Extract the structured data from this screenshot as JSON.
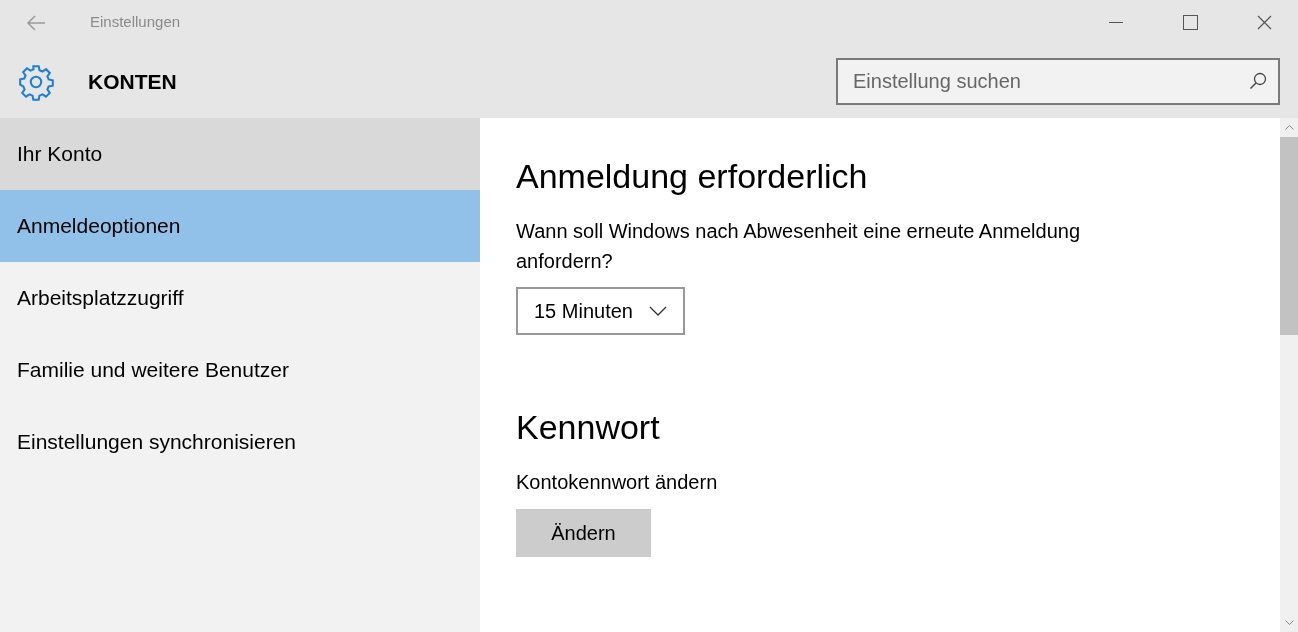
{
  "window": {
    "title": "Einstellungen"
  },
  "header": {
    "title": "KONTEN",
    "search": {
      "placeholder": "Einstellung suchen"
    }
  },
  "sidebar": {
    "items": [
      {
        "label": "Ihr Konto",
        "selected": false,
        "hovered": true
      },
      {
        "label": "Anmeldeoptionen",
        "selected": true,
        "hovered": false
      },
      {
        "label": "Arbeitsplatzzugriff",
        "selected": false,
        "hovered": false
      },
      {
        "label": "Familie und weitere Benutzer",
        "selected": false,
        "hovered": false
      },
      {
        "label": "Einstellungen synchronisieren",
        "selected": false,
        "hovered": false
      }
    ]
  },
  "sections": [
    {
      "heading": "Anmeldung erforderlich",
      "text": "Wann soll Windows nach Abwesenheit eine erneute Anmeldung anfordern?",
      "kind": "dropdown",
      "value": "15 Minuten"
    },
    {
      "heading": "Kennwort",
      "text": "Kontokennwort ändern",
      "kind": "button",
      "value": "Ändern"
    }
  ]
}
